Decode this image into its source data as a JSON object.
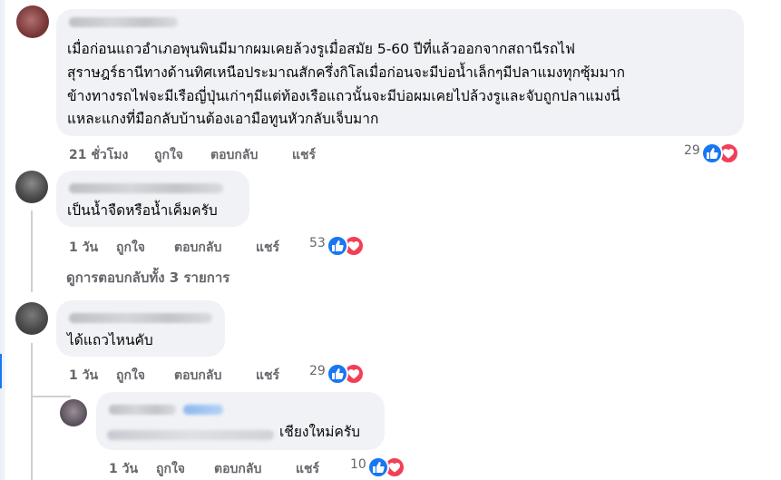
{
  "comments": [
    {
      "lines": [
        "เมื่อก่อนแถวอำเภอพุนพินมีมากผมเคยล้วงรูเมื่อสมัย 5-60 ปีที่แล้วออกจากสถานีรถไฟ",
        "สุราษฎร์ธานีทางด้านทิศเหนือประมาณสักครึ่งกิโลเมื่อก่อนจะมีบ่อน้ำเล็กๆมีปลาแมงทุกซุ้มมาก",
        "ข้างทางรถไฟจะมีเรือญี่ปุ่นเก่าๆมีแต่ท้องเรือแถวนั้นจะมีบ่อผมเคยไปล้วงรูและจับถูกปลาแมงนี่",
        "แหละแกงที่มือกลับบ้านต้องเอามือทูนหัวกลับเจ็บมาก"
      ],
      "time": "21 ชั่วโมง",
      "like": "ถูกใจ",
      "reply": "ตอบกลับ",
      "share": "แชร์",
      "reaction_count": "29"
    },
    {
      "lines": [
        "เป็นน้ำจืดหรือน้ำเค็มครับ"
      ],
      "time": "1 วัน",
      "like": "ถูกใจ",
      "reply": "ตอบกลับ",
      "share": "แชร์",
      "reaction_count": "53"
    },
    {
      "lines": [
        "ได้แถวไหนคับ"
      ],
      "time": "1 วัน",
      "like": "ถูกใจ",
      "reply": "ตอบกลับ",
      "share": "แชร์",
      "reaction_count": "29"
    },
    {
      "lines": [
        "เชียงใหม่ครับ"
      ],
      "time": "1 วัน",
      "like": "ถูกใจ",
      "reply": "ตอบกลับ",
      "share": "แชร์",
      "reaction_count": "10"
    }
  ],
  "view_replies": "ดูการตอบกลับทั้ง 3 รายการ",
  "colors": {
    "bubble": "#f0f2f5",
    "meta_text": "#65676b",
    "like_blue": "#1877f2",
    "love_red": "#f33e58"
  },
  "icons": [
    "like-icon",
    "love-icon"
  ]
}
